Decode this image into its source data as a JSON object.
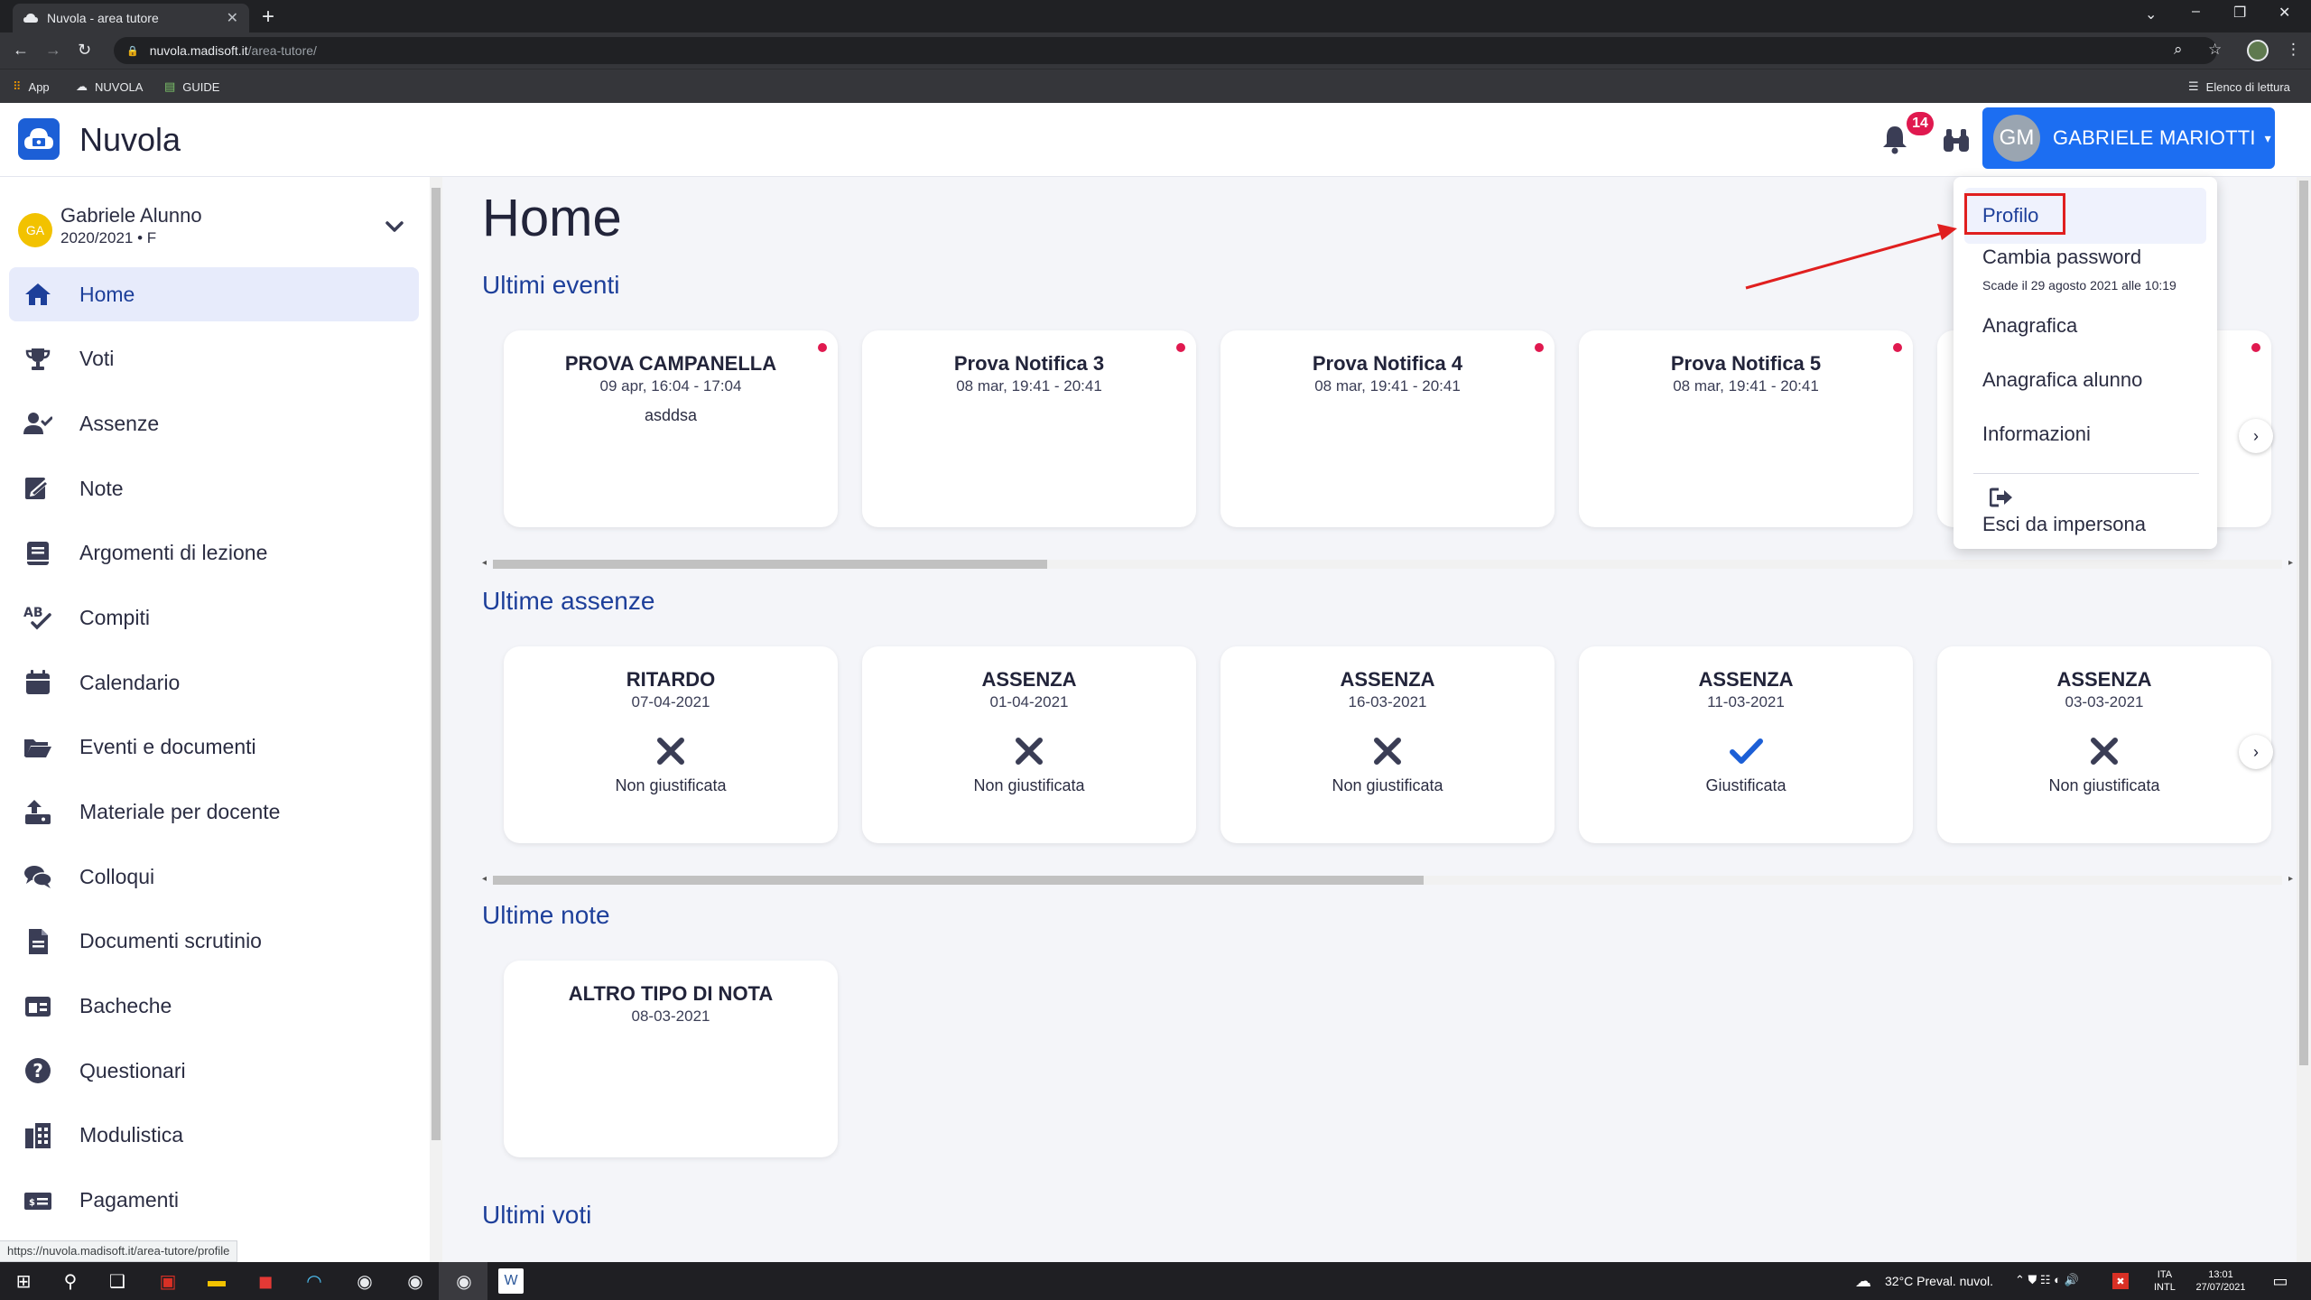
{
  "browser": {
    "tab_title": "Nuvola - area tutore",
    "url_host": "nuvola.madisoft.it",
    "url_path": "/area-tutore/",
    "bookmarks": [
      "App",
      "NUVOLA",
      "GUIDE"
    ],
    "reading_list": "Elenco di lettura",
    "status_url": "https://nuvola.madisoft.it/area-tutore/profile"
  },
  "header": {
    "app_name": "Nuvola",
    "notification_count": "14",
    "user_initials": "GM",
    "user_name": "GABRIELE MARIOTTI",
    "caret": "▾"
  },
  "student": {
    "initials": "GA",
    "name": "Gabriele Alunno",
    "year": "2020/2021 • F"
  },
  "sidebar": {
    "items": [
      {
        "label": "Home",
        "icon": "home-icon"
      },
      {
        "label": "Voti",
        "icon": "trophy-icon"
      },
      {
        "label": "Assenze",
        "icon": "user-check-icon"
      },
      {
        "label": "Note",
        "icon": "note-edit-icon"
      },
      {
        "label": "Argomenti di lezione",
        "icon": "book-icon"
      },
      {
        "label": "Compiti",
        "icon": "spell-check-icon"
      },
      {
        "label": "Calendario",
        "icon": "calendar-icon"
      },
      {
        "label": "Eventi e documenti",
        "icon": "folder-open-icon"
      },
      {
        "label": "Materiale per docente",
        "icon": "upload-material-icon"
      },
      {
        "label": "Colloqui",
        "icon": "chat-icon"
      },
      {
        "label": "Documenti scrutinio",
        "icon": "document-icon"
      },
      {
        "label": "Bacheche",
        "icon": "board-icon"
      },
      {
        "label": "Questionari",
        "icon": "question-icon"
      },
      {
        "label": "Modulistica",
        "icon": "forms-icon"
      },
      {
        "label": "Pagamenti",
        "icon": "payment-icon"
      }
    ]
  },
  "main": {
    "page_title": "Home",
    "events_title": "Ultimi eventi",
    "events": [
      {
        "title": "PROVA CAMPANELLA",
        "date": "09 apr, 16:04 - 17:04",
        "desc": "asddsa"
      },
      {
        "title": "Prova Notifica 3",
        "date": "08 mar, 19:41 - 20:41",
        "desc": ""
      },
      {
        "title": "Prova Notifica 4",
        "date": "08 mar, 19:41 - 20:41",
        "desc": ""
      },
      {
        "title": "Prova Notifica 5",
        "date": "08 mar, 19:41 - 20:41",
        "desc": ""
      }
    ],
    "absences_title": "Ultime assenze",
    "absences": [
      {
        "type": "RITARDO",
        "date": "07-04-2021",
        "status": "Non giustificata",
        "justified": false
      },
      {
        "type": "ASSENZA",
        "date": "01-04-2021",
        "status": "Non giustificata",
        "justified": false
      },
      {
        "type": "ASSENZA",
        "date": "16-03-2021",
        "status": "Non giustificata",
        "justified": false
      },
      {
        "type": "ASSENZA",
        "date": "11-03-2021",
        "status": "Giustificata",
        "justified": true
      },
      {
        "type": "ASSENZA",
        "date": "03-03-2021",
        "status": "Non giustificata",
        "justified": false
      }
    ],
    "notes_title": "Ultime note",
    "notes": [
      {
        "title": "ALTRO TIPO DI NOTA",
        "date": "08-03-2021"
      }
    ],
    "grades_title": "Ultimi voti",
    "events_scroll_fraction": 0.31,
    "absences_scroll_fraction": 0.52
  },
  "dropdown": {
    "profile": "Profilo",
    "change_password": "Cambia password",
    "password_expiry": "Scade il 29 agosto 2021 alle 10:19",
    "registry": "Anagrafica",
    "student_registry": "Anagrafica alunno",
    "info": "Informazioni",
    "exit_impersonate": "Esci da impersona"
  },
  "taskbar": {
    "weather": "32°C  Preval. nuvol.",
    "lang_top": "ITA",
    "lang_bottom": "INTL",
    "time": "13:01",
    "date": "27/07/2021"
  },
  "colors": {
    "primary": "#1c6ef2",
    "title_blue": "#1d3f9a",
    "badge_red": "#e0194f",
    "annotation_red": "#e01f1f"
  }
}
